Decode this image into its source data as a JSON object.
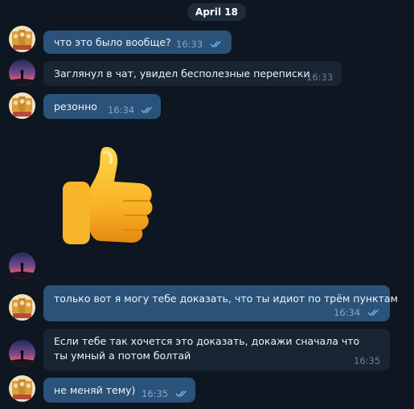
{
  "date_label": "April 18",
  "colors": {
    "background": "#0e1621",
    "outgoing_bubble": "#2b5278",
    "incoming_bubble": "#182533",
    "read_check": "#6ab2f2"
  },
  "messages": [
    {
      "text": "что это было вообще?",
      "time": "16:33",
      "direction": "outgoing",
      "read": true
    },
    {
      "text": "Заглянул в чат, увидел бесполезные переписки",
      "time": "16:33",
      "direction": "incoming"
    },
    {
      "text": "резонно",
      "time": "16:34",
      "direction": "outgoing",
      "read": true
    },
    {
      "sticker": "thumbs-up",
      "direction": "incoming"
    },
    {
      "text": "только вот я могу тебе доказать, что ты идиот по трём пунктам",
      "time": "16:34",
      "direction": "outgoing",
      "read": true
    },
    {
      "text": "Если тебе так хочется это доказать, докажи сначала что ты умный а потом болтай",
      "time": "16:35",
      "direction": "incoming"
    },
    {
      "text": "не меняй тему)",
      "time": "16:35",
      "direction": "outgoing",
      "read": true
    }
  ]
}
